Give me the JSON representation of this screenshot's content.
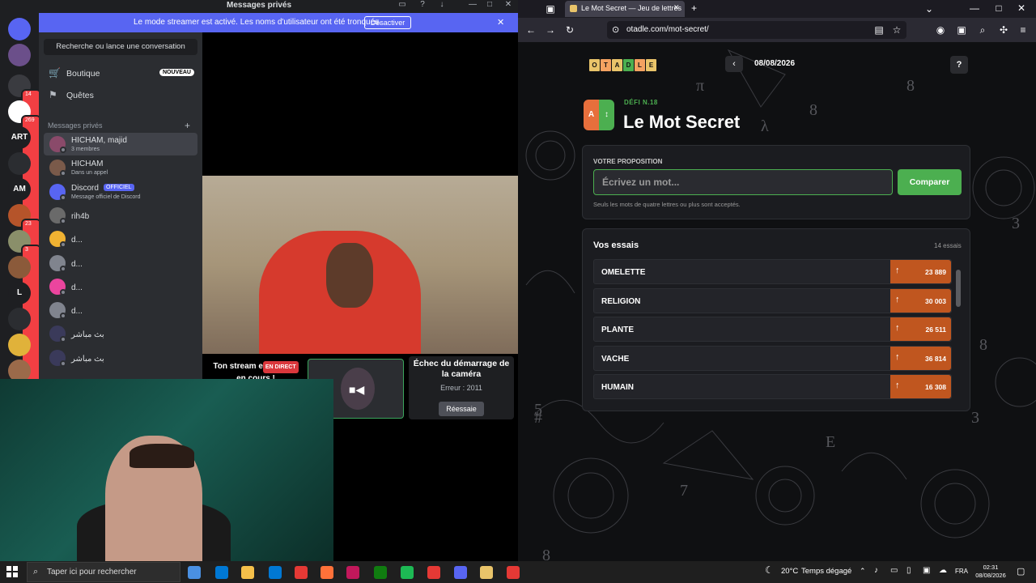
{
  "discord": {
    "window_title": "Messages privés",
    "banner": {
      "text": "Le mode streamer est activé. Les noms d'utilisateur ont été tronqués.",
      "button": "Désactiver"
    },
    "servers": [
      {
        "label": "",
        "color": "#5865f2",
        "badge": ""
      },
      {
        "label": "",
        "color": "#6b4f8a",
        "badge": ""
      },
      {
        "label": "",
        "color": "#3a3b40",
        "badge": "14"
      },
      {
        "label": "",
        "color": "#ffffff",
        "badge": "269"
      },
      {
        "label": "ART",
        "color": "#1e1f22",
        "badge": ""
      },
      {
        "label": "",
        "color": "#2b2d31",
        "badge": ""
      },
      {
        "label": "AM",
        "color": "#1e1f22",
        "badge": ""
      },
      {
        "label": "",
        "color": "#b5542a",
        "badge": "23"
      },
      {
        "label": "",
        "color": "#8a8f6a",
        "badge": "3"
      },
      {
        "label": "",
        "color": "#8b5a3a",
        "badge": ""
      },
      {
        "label": "L",
        "color": "#1e1f22",
        "badge": ""
      },
      {
        "label": "",
        "color": "#2b2d31",
        "badge": ""
      },
      {
        "label": "",
        "color": "#e0b23a",
        "badge": ""
      },
      {
        "label": "",
        "color": "#9b6a4a",
        "badge": ""
      }
    ],
    "search_placeholder": "Recherche ou lance une conversation",
    "nav": {
      "shop": "Boutique",
      "shop_badge": "NOUVEAU",
      "quests": "Quêtes"
    },
    "dm_section": "Messages privés",
    "dms": [
      {
        "name": "HICHAM, majid",
        "sub": "3 membres",
        "color": "#8a4a6a"
      },
      {
        "name": "HICHAM",
        "sub": "Dans un appel",
        "color": "#7a5a4a"
      },
      {
        "name": "Discord",
        "badge": "OFFICIEL",
        "sub": "Message officiel de Discord",
        "color": "#5865f2"
      },
      {
        "name": "rih4b",
        "sub": "",
        "color": "#6a6a6a"
      },
      {
        "name": "d...",
        "sub": "",
        "color": "#f0b232"
      },
      {
        "name": "d...",
        "sub": "",
        "color": "#80848e"
      },
      {
        "name": "d...",
        "sub": "",
        "color": "#eb459e"
      },
      {
        "name": "d...",
        "sub": "",
        "color": "#80848e"
      },
      {
        "name": "بث مباشر",
        "sub": "",
        "color": "#3a3a5a"
      },
      {
        "name": "بث مباشر",
        "sub": "",
        "color": "#3a3a5a"
      }
    ],
    "stream": {
      "label_1": "Ton stream e",
      "live": "EN DIRECT",
      "label_2": "en cours !",
      "camera_fail": "Échec du démarrage de la caméra",
      "error": "Erreur : 2011",
      "retry": "Réessaie"
    }
  },
  "browser": {
    "tab_title": "Le Mot Secret — Jeu de lettres",
    "url": "otadle.com/mot-secret/"
  },
  "game": {
    "logo": [
      "O",
      "T",
      "A",
      "D",
      "L",
      "E"
    ],
    "logo_colors": [
      "#e9c46a",
      "#f4a261",
      "#e9c46a",
      "#4caf50",
      "#f4a261",
      "#e9c46a"
    ],
    "date": "08/08/2026",
    "help": "?",
    "icon_left": "A",
    "icon_right": "↕",
    "defi": "DÉFI N.18",
    "title": "Le Mot Secret",
    "proposal_label": "VOTRE PROPOSITION",
    "input_placeholder": "Écrivez un mot...",
    "compare_button": "Comparer",
    "hint": "Seuls les mots de quatre lettres ou plus sont acceptés.",
    "essais_title": "Vos essais",
    "essais_count": "14 essais",
    "guesses": [
      {
        "word": "OMELETTE",
        "score": "23 889",
        "direction": "↑"
      },
      {
        "word": "RELIGION",
        "score": "30 003",
        "direction": "↑"
      },
      {
        "word": "PLANTE",
        "score": "26 511",
        "direction": "↑"
      },
      {
        "word": "VACHE",
        "score": "36 814",
        "direction": "↑"
      },
      {
        "word": "HUMAIN",
        "score": "16 308",
        "direction": "↑"
      }
    ]
  },
  "taskbar": {
    "search": "Taper ici pour rechercher",
    "temperature": "20°C",
    "weather": "Temps dégagé",
    "lang": "FRA",
    "time": "02:31",
    "date": "08/08/2026",
    "apps": [
      "#4a90e2",
      "#0078d4",
      "#f5c04a",
      "#0078d4",
      "#e53935",
      "#ff7139",
      "#c2185b",
      "#107c10",
      "#1db954",
      "#e53935",
      "#5865f2",
      "#e9c46a",
      "#e53935"
    ]
  }
}
